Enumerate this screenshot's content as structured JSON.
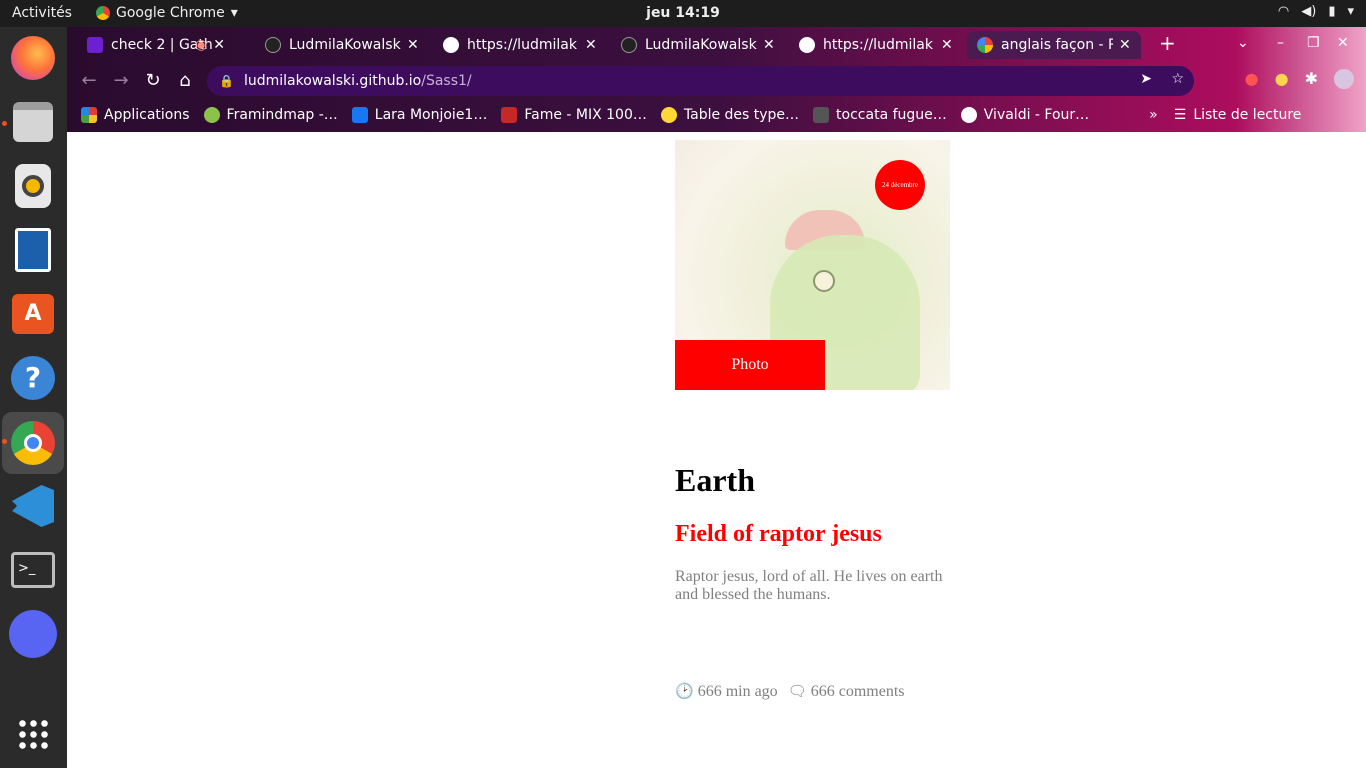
{
  "topbar": {
    "activities": "Activités",
    "app_name": "Google Chrome",
    "clock": "jeu 14:19"
  },
  "tabs": [
    {
      "label": "check 2 | Gath",
      "color": "#6b21d0"
    },
    {
      "label": "LudmilaKowalsk",
      "color": "#222222"
    },
    {
      "label": "https://ludmilak",
      "color": "#ffffff"
    },
    {
      "label": "LudmilaKowalsk",
      "color": "#222222"
    },
    {
      "label": "https://ludmilak",
      "color": "#ffffff"
    },
    {
      "label": "anglais façon - R",
      "color": "#4285f4"
    }
  ],
  "address": {
    "host": "ludmilakowalski.github.io",
    "path": "/Sass1/"
  },
  "bookmarks": [
    {
      "label": "Applications",
      "color": "#e53935"
    },
    {
      "label": "Framindmap -…",
      "color": "#8bc34a"
    },
    {
      "label": "Lara Monjoie1…",
      "color": "#1877f2"
    },
    {
      "label": "Fame - MIX 100…",
      "color": "#c62828"
    },
    {
      "label": "Table des type…",
      "color": "#fdd835"
    },
    {
      "label": "toccata fugue…",
      "color": "#ffffff"
    },
    {
      "label": "Vivaldi - Four…",
      "color": "#ffffff"
    }
  ],
  "reading_list": "Liste de lecture",
  "article": {
    "date_badge": "24 décembre",
    "photo_label": "Photo",
    "title": "Earth",
    "subtitle": "Field of raptor jesus",
    "body": "Raptor jesus, lord of all. He lives on earth and blessed the humans.",
    "time": "666 min ago",
    "comments": "666 comments"
  }
}
